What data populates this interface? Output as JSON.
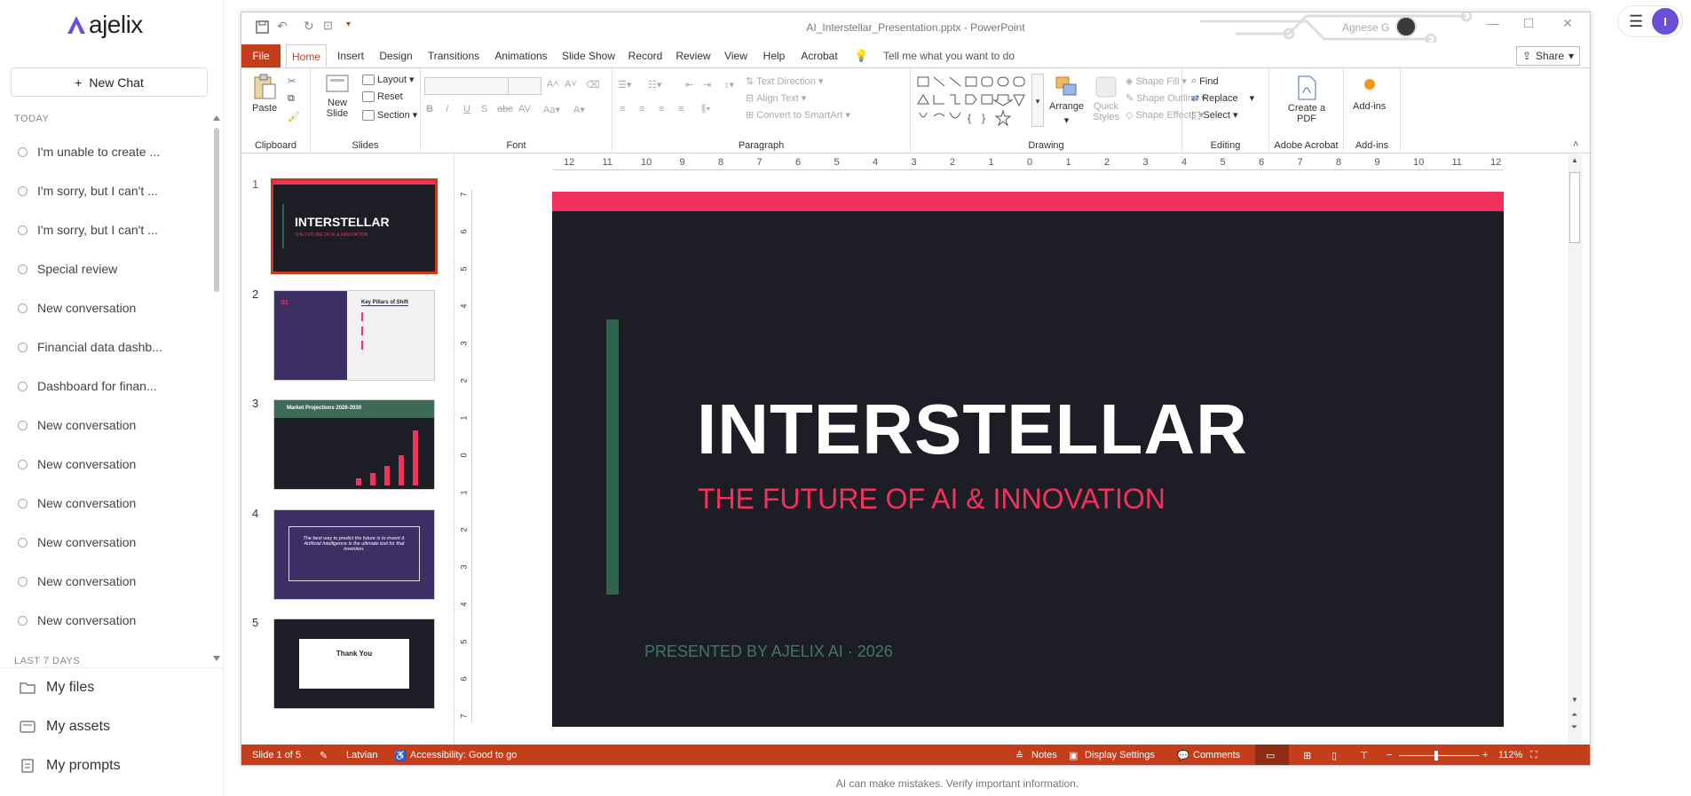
{
  "app": {
    "logo": "ajelix",
    "new_chat": "New Chat",
    "footer": "AI can make mistakes. Verify important information.",
    "avatar_initial": "I",
    "sections": {
      "today": "TODAY",
      "last7": "LAST 7 DAYS"
    },
    "conversations": [
      "I'm unable to create ...",
      "I'm sorry, but I can't ...",
      "I'm sorry, but I can't ...",
      "Special review",
      "New conversation",
      "Financial data dashb...",
      "Dashboard for finan...",
      "New conversation",
      "New conversation",
      "New conversation",
      "New conversation",
      "New conversation",
      "New conversation"
    ],
    "bottom_nav": [
      "My files",
      "My assets",
      "My prompts"
    ]
  },
  "ppt": {
    "window_title": "AI_Interstellar_Presentation.pptx - PowerPoint",
    "user": "Agnese G",
    "tabs": [
      "File",
      "Home",
      "Insert",
      "Design",
      "Transitions",
      "Animations",
      "Slide Show",
      "Record",
      "Review",
      "View",
      "Help",
      "Acrobat"
    ],
    "tell_me": "Tell me what you want to do",
    "share": "Share",
    "ribbon": {
      "clipboard": {
        "label": "Clipboard",
        "paste": "Paste"
      },
      "slides": {
        "label": "Slides",
        "new_slide": "New Slide",
        "layout": "Layout",
        "reset": "Reset",
        "section": "Section"
      },
      "font": {
        "label": "Font"
      },
      "paragraph": {
        "label": "Paragraph",
        "text_direction": "Text Direction",
        "align_text": "Align Text",
        "smartart": "Convert to SmartArt"
      },
      "drawing": {
        "label": "Drawing",
        "arrange": "Arrange",
        "quick_styles": "Quick Styles",
        "shape_fill": "Shape Fill",
        "shape_outline": "Shape Outline",
        "shape_effects": "Shape Effects"
      },
      "editing": {
        "label": "Editing",
        "find": "Find",
        "replace": "Replace",
        "select": "Select"
      },
      "acrobat": {
        "label": "Adobe Acrobat",
        "create_pdf": "Create a PDF"
      },
      "addins": {
        "label": "Add-ins",
        "addins": "Add-ins"
      }
    },
    "ruler_h": [
      "12",
      "11",
      "10",
      "9",
      "8",
      "7",
      "6",
      "5",
      "4",
      "3",
      "2",
      "1",
      "0",
      "1",
      "2",
      "3",
      "4",
      "5",
      "6",
      "7",
      "8",
      "9",
      "10",
      "11",
      "12"
    ],
    "ruler_v": [
      "7",
      "6",
      "5",
      "4",
      "3",
      "2",
      "1",
      "0",
      "1",
      "2",
      "3",
      "4",
      "5",
      "6",
      "7"
    ],
    "thumbnails": [
      {
        "num": "1",
        "title": "INTERSTELLAR",
        "subtitle": "THE FUTURE OF AI & INNOVATION"
      },
      {
        "num": "2",
        "badge": "01",
        "title": "Key Pillars of Shift"
      },
      {
        "num": "3",
        "title": "Market Projections 2026-2030"
      },
      {
        "num": "4",
        "quote": "The best way to predict the future is to invent it. Artificial Intelligence is the ultimate tool for that invention."
      },
      {
        "num": "5",
        "title": "Thank You"
      }
    ],
    "slide": {
      "title": "INTERSTELLAR",
      "subtitle": "THE FUTURE OF AI & INNOVATION",
      "presented": "PRESENTED BY AJELIX AI · 2026"
    },
    "status": {
      "slide": "Slide 1 of 5",
      "language": "Latvian",
      "accessibility": "Accessibility: Good to go",
      "notes": "Notes",
      "display": "Display Settings",
      "comments": "Comments",
      "zoom": "112%"
    },
    "colors": {
      "accent": "#c43e1c",
      "slide_bg": "#1c1d25",
      "slide_pink": "#f4315d",
      "slide_green": "#2f6350"
    }
  }
}
